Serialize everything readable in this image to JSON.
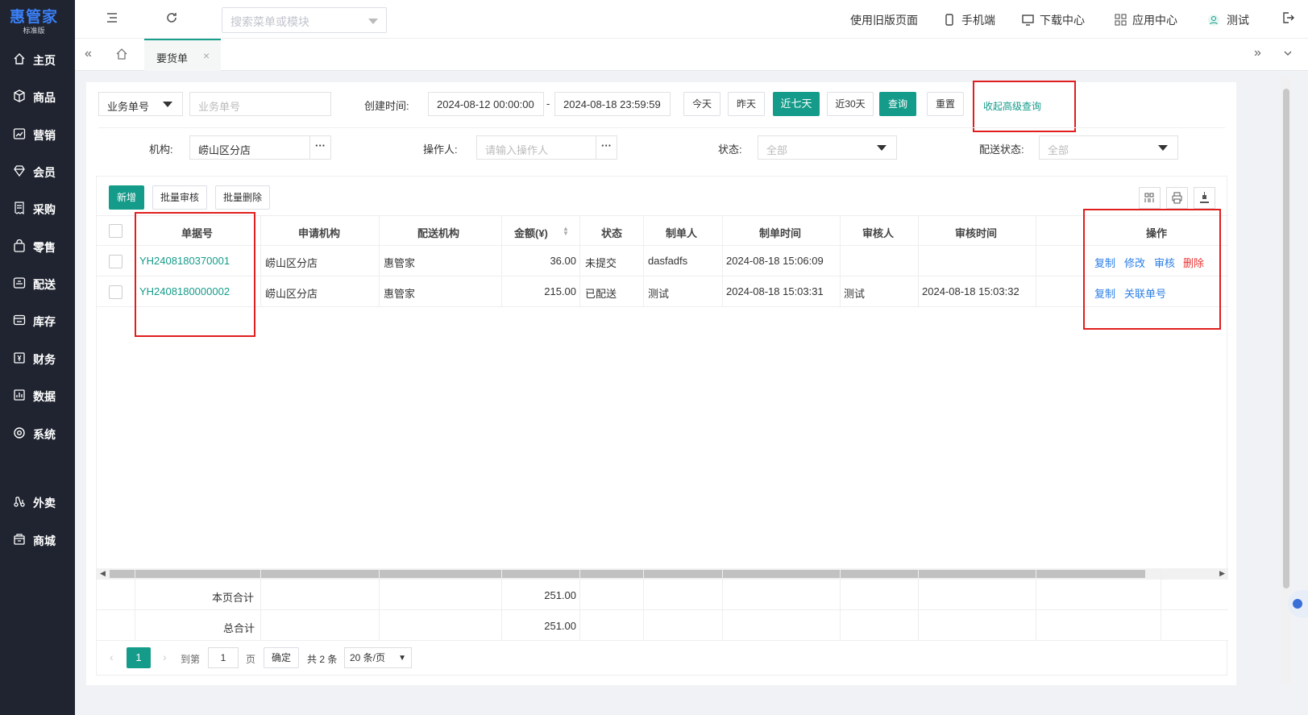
{
  "brand": {
    "name": "惠管家",
    "edition": "标准版"
  },
  "sidebar": {
    "items": [
      {
        "label": "主页",
        "icon": "home-icon"
      },
      {
        "label": "商品",
        "icon": "box-icon"
      },
      {
        "label": "营销",
        "icon": "chart-icon"
      },
      {
        "label": "会员",
        "icon": "diamond-icon"
      },
      {
        "label": "采购",
        "icon": "receipt-icon"
      },
      {
        "label": "零售",
        "icon": "bag-icon"
      },
      {
        "label": "配送",
        "icon": "truck-icon"
      },
      {
        "label": "库存",
        "icon": "inventory-icon"
      },
      {
        "label": "财务",
        "icon": "finance-icon"
      },
      {
        "label": "数据",
        "icon": "data-icon"
      },
      {
        "label": "系统",
        "icon": "system-icon"
      },
      {
        "label": "外卖",
        "icon": "takeout-icon"
      },
      {
        "label": "商城",
        "icon": "mall-icon"
      }
    ]
  },
  "header": {
    "search_placeholder": "搜索菜单或模块",
    "links": {
      "old": "使用旧版页面",
      "mobile": "手机端",
      "download": "下载中心",
      "apps": "应用中心",
      "user": "测试"
    }
  },
  "tabs": {
    "active": "要货单"
  },
  "filters": {
    "doc_type": "业务单号",
    "doc_placeholder": "业务单号",
    "created_label": "创建时间:",
    "date_from": "2024-08-12 00:00:00",
    "date_sep": "-",
    "date_to": "2024-08-18 23:59:59",
    "btn_today": "今天",
    "btn_yesterday": "昨天",
    "btn_7days": "近七天",
    "btn_30days": "近30天",
    "btn_query": "查询",
    "btn_reset": "重置",
    "collapse": "收起高级查询",
    "org_label": "机构:",
    "org_value": "崂山区分店",
    "operator_label": "操作人:",
    "operator_placeholder": "请输入操作人",
    "status_label": "状态:",
    "status_value": "全部",
    "delivery_label": "配送状态:",
    "delivery_value": "全部"
  },
  "toolbar": {
    "add": "新增",
    "batch_audit": "批量审核",
    "batch_delete": "批量删除"
  },
  "table": {
    "headers": [
      "单据号",
      "申请机构",
      "配送机构",
      "金额(¥)",
      "状态",
      "制单人",
      "制单时间",
      "审核人",
      "审核时间",
      "操作"
    ],
    "rows": [
      {
        "no": "YH2408180370001",
        "apply": "崂山区分店",
        "deliver": "惠管家",
        "amount": "36.00",
        "status": "未提交",
        "maker": "dasfadfs",
        "made_at": "2024-08-18 15:06:09",
        "auditor": "",
        "audited_at": "",
        "ops": [
          "复制",
          "修改",
          "审核",
          "删除"
        ]
      },
      {
        "no": "YH2408180000002",
        "apply": "崂山区分店",
        "deliver": "惠管家",
        "amount": "215.00",
        "status": "已配送",
        "maker": "测试",
        "made_at": "2024-08-18 15:03:31",
        "auditor": "测试",
        "audited_at": "2024-08-18 15:03:32",
        "ops": [
          "复制",
          "关联单号"
        ]
      }
    ],
    "page_total_label": "本页合计",
    "page_total": "251.00",
    "grand_total_label": "总合计",
    "grand_total": "251.00"
  },
  "pager": {
    "current": "1",
    "goto": "到第",
    "page_input": "1",
    "page_unit": "页",
    "confirm": "确定",
    "total": "共 2 条",
    "page_size": "20 条/页"
  }
}
